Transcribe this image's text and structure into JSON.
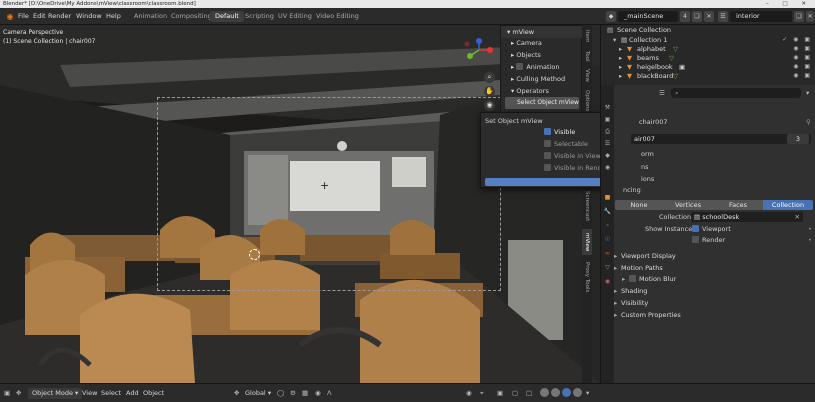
{
  "titlebar": {
    "title": "Blender* [D:\\OneDrive\\My Addons\\mView\\classroom\\classroom.blend]",
    "controls": "– □ ✕"
  },
  "menu": {
    "items": [
      "File",
      "Edit",
      "Render",
      "Window",
      "Help"
    ]
  },
  "workspaces": {
    "tabs": [
      "Animation",
      "Compositing",
      "Default",
      "Scripting",
      "UV Editing",
      "Video Editing"
    ],
    "active": "Default"
  },
  "scene": {
    "name": "_mainScene",
    "view_layer": "interior",
    "badge": "4"
  },
  "viewport": {
    "perspective": "Camera Perspective",
    "collection": "(1) Scene Collection | chair007"
  },
  "npanel": {
    "header": "mView",
    "items": [
      "Camera",
      "Objects",
      "Animation",
      "Culling Method",
      "Operators"
    ],
    "button": "Select Object mView"
  },
  "side_tabs": [
    "Item",
    "Tool",
    "View",
    "Options",
    "Screencast",
    "mView",
    "Proxy Tools"
  ],
  "popup": {
    "title": "Set Object mView",
    "options": [
      {
        "label": "Visible",
        "checked": true
      },
      {
        "label": "Selectable",
        "checked": false
      },
      {
        "label": "Visible in Viewport",
        "checked": false
      },
      {
        "label": "Visible in Render",
        "checked": false
      }
    ]
  },
  "outliner": {
    "root": "Scene Collection",
    "rows": [
      "Collection 1",
      "alphabet",
      "beams",
      "heigelbook",
      "blackBoard"
    ]
  },
  "properties": {
    "object_name": "chair007",
    "object_name_partial": "air007",
    "count": "3",
    "partial_labels": [
      "orm",
      "ns",
      "ions",
      "ncing"
    ],
    "instancing_modes": [
      "None",
      "Vertices",
      "Faces",
      "Collection"
    ],
    "instancing_active": "Collection",
    "collection_label": "Collection",
    "collection_value": "schoolDesk",
    "show_instancer_label": "Show Instancer",
    "viewport_label": "Viewport",
    "render_label": "Render",
    "sections": [
      "Viewport Display",
      "Motion Paths",
      "Motion Blur",
      "Shading",
      "Visibility",
      "Custom Properties"
    ]
  },
  "statusbar": {
    "mode": "Object Mode",
    "menu": [
      "View",
      "Select",
      "Add",
      "Object"
    ],
    "transform": "Global"
  },
  "colors": {
    "accent": "#4772b3",
    "logo": "#e87d0d"
  }
}
